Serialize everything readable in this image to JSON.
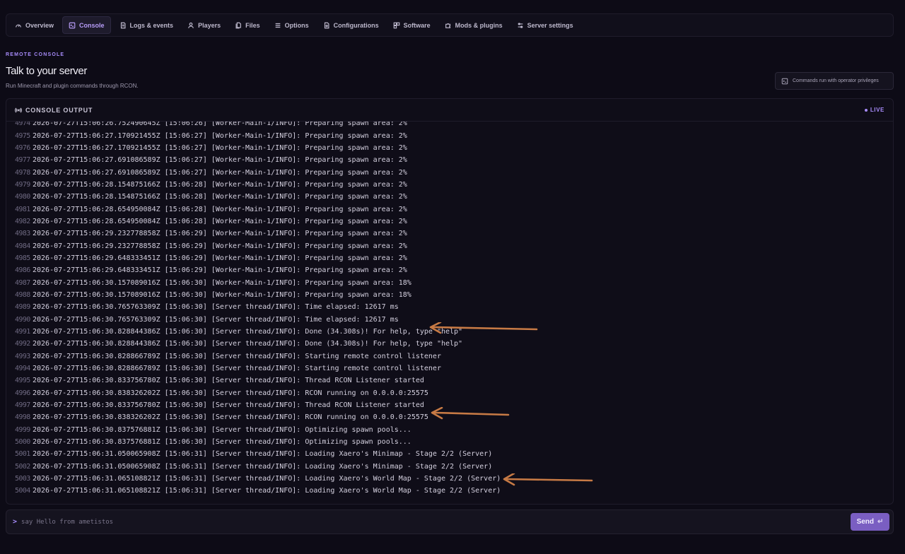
{
  "tabs": [
    {
      "label": "Overview",
      "icon": "gauge-icon"
    },
    {
      "label": "Console",
      "icon": "terminal-icon",
      "active": true
    },
    {
      "label": "Logs & events",
      "icon": "logs-icon"
    },
    {
      "label": "Players",
      "icon": "user-icon"
    },
    {
      "label": "Files",
      "icon": "files-icon"
    },
    {
      "label": "Options",
      "icon": "list-icon"
    },
    {
      "label": "Configurations",
      "icon": "config-file-icon"
    },
    {
      "label": "Software",
      "icon": "package-icon"
    },
    {
      "label": "Mods & plugins",
      "icon": "puzzle-icon"
    },
    {
      "label": "Server settings",
      "icon": "sliders-icon"
    }
  ],
  "header": {
    "eyebrow": "REMOTE CONSOLE",
    "title": "Talk to your server",
    "subtitle": "Run Minecraft and plugin commands through RCON.",
    "privileges": "Commands run with operator privileges"
  },
  "console": {
    "title": "CONSOLE OUTPUT",
    "status": "LIVE",
    "accent": "#a78bfa",
    "annotation_color": "#c77a45",
    "lines": [
      {
        "n": "4974",
        "text": "2026-07-27T15:06:26.752490645Z [15:06:26] [Worker-Main-1/INFO]: Preparing spawn area: 2%"
      },
      {
        "n": "4975",
        "text": "2026-07-27T15:06:27.170921455Z [15:06:27] [Worker-Main-1/INFO]: Preparing spawn area: 2%"
      },
      {
        "n": "4976",
        "text": "2026-07-27T15:06:27.170921455Z [15:06:27] [Worker-Main-1/INFO]: Preparing spawn area: 2%"
      },
      {
        "n": "4977",
        "text": "2026-07-27T15:06:27.691086589Z [15:06:27] [Worker-Main-1/INFO]: Preparing spawn area: 2%"
      },
      {
        "n": "4978",
        "text": "2026-07-27T15:06:27.691086589Z [15:06:27] [Worker-Main-1/INFO]: Preparing spawn area: 2%"
      },
      {
        "n": "4979",
        "text": "2026-07-27T15:06:28.154875166Z [15:06:28] [Worker-Main-1/INFO]: Preparing spawn area: 2%"
      },
      {
        "n": "4980",
        "text": "2026-07-27T15:06:28.154875166Z [15:06:28] [Worker-Main-1/INFO]: Preparing spawn area: 2%"
      },
      {
        "n": "4981",
        "text": "2026-07-27T15:06:28.654950084Z [15:06:28] [Worker-Main-1/INFO]: Preparing spawn area: 2%"
      },
      {
        "n": "4982",
        "text": "2026-07-27T15:06:28.654950084Z [15:06:28] [Worker-Main-1/INFO]: Preparing spawn area: 2%"
      },
      {
        "n": "4983",
        "text": "2026-07-27T15:06:29.232778858Z [15:06:29] [Worker-Main-1/INFO]: Preparing spawn area: 2%"
      },
      {
        "n": "4984",
        "text": "2026-07-27T15:06:29.232778858Z [15:06:29] [Worker-Main-1/INFO]: Preparing spawn area: 2%"
      },
      {
        "n": "4985",
        "text": "2026-07-27T15:06:29.648333451Z [15:06:29] [Worker-Main-1/INFO]: Preparing spawn area: 2%"
      },
      {
        "n": "4986",
        "text": "2026-07-27T15:06:29.648333451Z [15:06:29] [Worker-Main-1/INFO]: Preparing spawn area: 2%"
      },
      {
        "n": "4987",
        "text": "2026-07-27T15:06:30.157089016Z [15:06:30] [Worker-Main-1/INFO]: Preparing spawn area: 18%"
      },
      {
        "n": "4988",
        "text": "2026-07-27T15:06:30.157089016Z [15:06:30] [Worker-Main-1/INFO]: Preparing spawn area: 18%"
      },
      {
        "n": "4989",
        "text": "2026-07-27T15:06:30.765763309Z [15:06:30] [Server thread/INFO]: Time elapsed: 12617 ms"
      },
      {
        "n": "4990",
        "text": "2026-07-27T15:06:30.765763309Z [15:06:30] [Server thread/INFO]: Time elapsed: 12617 ms"
      },
      {
        "n": "4991",
        "text": "2026-07-27T15:06:30.828844386Z [15:06:30] [Server thread/INFO]: Done (34.308s)! For help, type \"help\""
      },
      {
        "n": "4992",
        "text": "2026-07-27T15:06:30.828844386Z [15:06:30] [Server thread/INFO]: Done (34.308s)! For help, type \"help\""
      },
      {
        "n": "4993",
        "text": "2026-07-27T15:06:30.828866789Z [15:06:30] [Server thread/INFO]: Starting remote control listener"
      },
      {
        "n": "4994",
        "text": "2026-07-27T15:06:30.828866789Z [15:06:30] [Server thread/INFO]: Starting remote control listener"
      },
      {
        "n": "4995",
        "text": "2026-07-27T15:06:30.833756780Z [15:06:30] [Server thread/INFO]: Thread RCON Listener started"
      },
      {
        "n": "4996",
        "text": "2026-07-27T15:06:30.838326202Z [15:06:30] [Server thread/INFO]: RCON running on 0.0.0.0:25575"
      },
      {
        "n": "4997",
        "text": "2026-07-27T15:06:30.833756780Z [15:06:30] [Server thread/INFO]: Thread RCON Listener started"
      },
      {
        "n": "4998",
        "text": "2026-07-27T15:06:30.838326202Z [15:06:30] [Server thread/INFO]: RCON running on 0.0.0.0:25575"
      },
      {
        "n": "4999",
        "text": "2026-07-27T15:06:30.837576881Z [15:06:30] [Server thread/INFO]: Optimizing spawn pools..."
      },
      {
        "n": "5000",
        "text": "2026-07-27T15:06:30.837576881Z [15:06:30] [Server thread/INFO]: Optimizing spawn pools..."
      },
      {
        "n": "5001",
        "text": "2026-07-27T15:06:31.050065908Z [15:06:31] [Server thread/INFO]: Loading Xaero's Minimap - Stage 2/2 (Server)"
      },
      {
        "n": "5002",
        "text": "2026-07-27T15:06:31.050065908Z [15:06:31] [Server thread/INFO]: Loading Xaero's Minimap - Stage 2/2 (Server)"
      },
      {
        "n": "5003",
        "text": "2026-07-27T15:06:31.065108821Z [15:06:31] [Server thread/INFO]: Loading Xaero's World Map - Stage 2/2 (Server)"
      },
      {
        "n": "5004",
        "text": "2026-07-27T15:06:31.065108821Z [15:06:31] [Server thread/INFO]: Loading Xaero's World Map - Stage 2/2 (Server)"
      }
    ]
  },
  "input": {
    "prompt": ">",
    "placeholder": "say Hello from ametistos",
    "send_label": "Send",
    "send_hint": "↵",
    "send_color": "#7a5ec2"
  }
}
